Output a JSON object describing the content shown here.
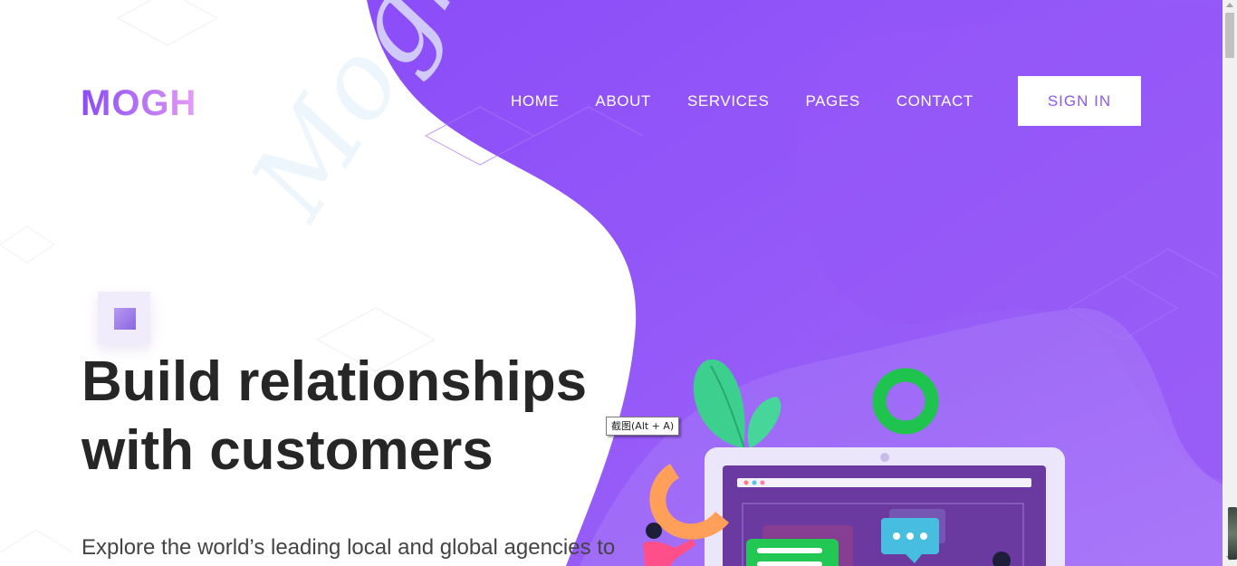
{
  "brand": {
    "logo": "MOGH",
    "watermark": "Mogh"
  },
  "nav": {
    "items": [
      "HOME",
      "ABOUT",
      "SERVICES",
      "PAGES",
      "CONTACT"
    ],
    "sign_in": "SIGN IN"
  },
  "hero": {
    "title_line1": "Build relationships",
    "title_line2": "with customers",
    "subtitle": "Explore the world’s leading local and global agencies to"
  },
  "tooltip": {
    "text": "截图(Alt + A)"
  },
  "colors": {
    "accent": "#8a4bf6",
    "accent_light": "#a78bfa",
    "leaf": "#36c586",
    "ring": "#1fc44f",
    "chart": "#ff9f5a",
    "card": "#23c753",
    "chat": "#47bde0"
  }
}
